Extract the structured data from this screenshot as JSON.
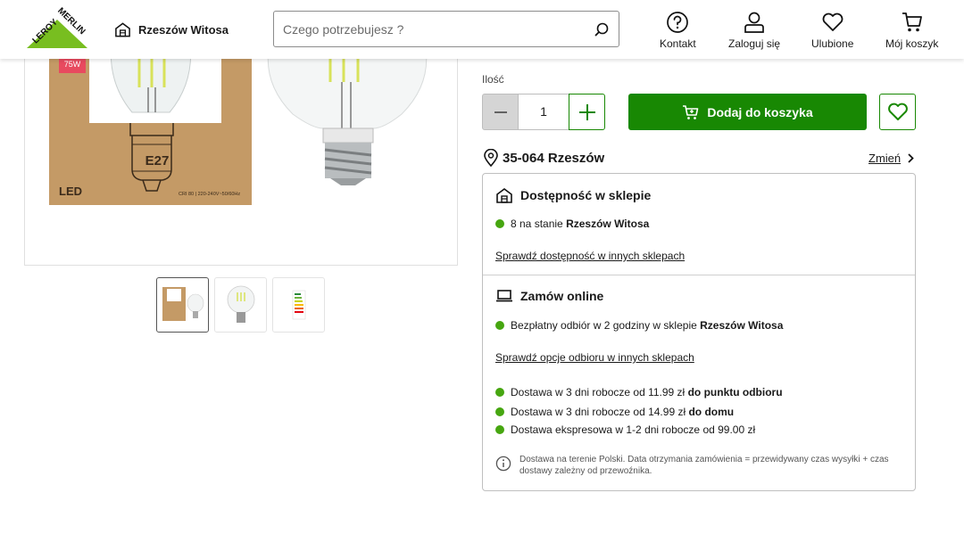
{
  "header": {
    "logo_text": "LEROY MERLIN",
    "store_name": "Rzeszów Witosa",
    "search": {
      "placeholder": "Czego potrzebujesz ?"
    },
    "nav": [
      {
        "label": "Kontakt",
        "icon": "help-circle-icon"
      },
      {
        "label": "Zaloguj się",
        "icon": "user-icon"
      },
      {
        "label": "Ulubione",
        "icon": "heart-icon"
      },
      {
        "label": "Mój koszyk",
        "icon": "cart-icon"
      }
    ]
  },
  "gallery": {
    "main_image_labels": {
      "power_badge": "75W",
      "socket": "E27",
      "type": "LED",
      "spec": "CRI 80 | 220-240V~50/60Hz"
    },
    "thumbnails": 3,
    "active_thumbnail": 1
  },
  "purchase": {
    "quantity_label": "Ilość",
    "quantity": "1",
    "add_to_cart": "Dodaj do koszyka"
  },
  "location": {
    "postal": "35-064 Rzeszów",
    "change": "Zmień"
  },
  "store_availability": {
    "title": "Dostępność w sklepie",
    "stock_prefix": "8 na stanie",
    "stock_store": "Rzeszów Witosa",
    "link": "Sprawdź dostępność w innych sklepach"
  },
  "online": {
    "title": "Zamów online",
    "pickup_prefix": "Bezpłatny odbiór w 2 godziny w sklepie",
    "pickup_store": "Rzeszów Witosa",
    "link": "Sprawdź opcje odbioru w innych sklepach",
    "deliveries": [
      {
        "text": "Dostawa w 3 dni robocze od 11.99 zł",
        "bold": "do punktu odbioru"
      },
      {
        "text": "Dostawa w 3 dni robocze od 14.99 zł",
        "bold": "do domu"
      },
      {
        "text": "Dostawa ekspresowa w 1-2 dni robocze od 99.00 zł",
        "bold": ""
      }
    ],
    "note": "Dostawa na terenie Polski. Data otrzymania zamówienia = przewidywany czas wysyłki + czas dostawy zależny od przewoźnika."
  },
  "colors": {
    "primary_green": "#188803",
    "status_green": "#46a610",
    "logo_green": "#78be20"
  }
}
